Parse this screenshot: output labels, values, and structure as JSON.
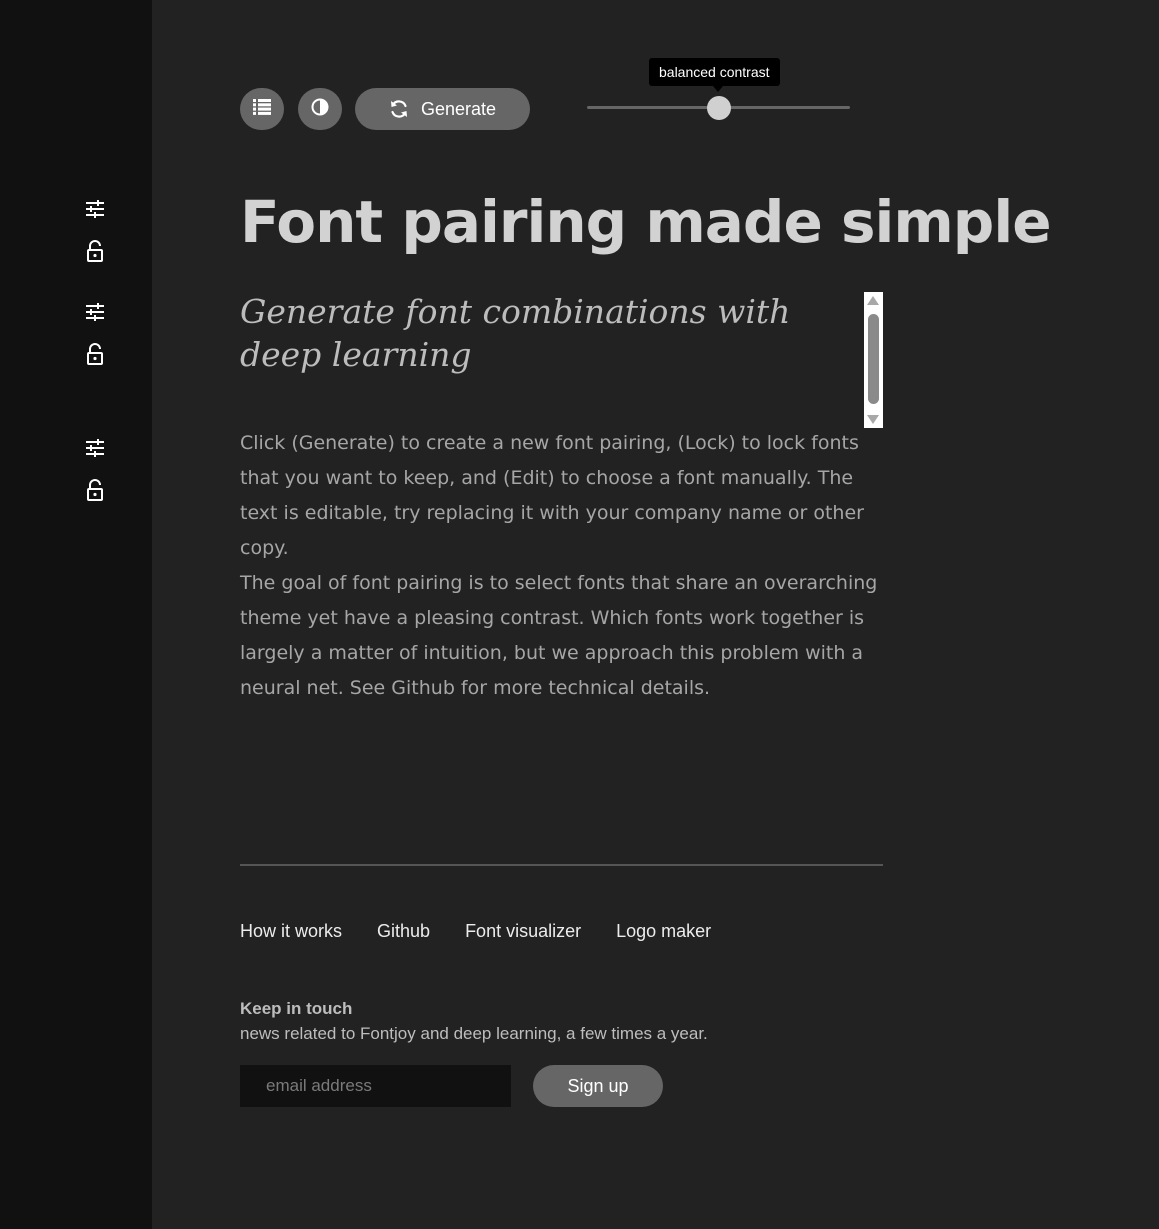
{
  "sidebar": {
    "font_slots": [
      {
        "edit_icon": "sliders-icon",
        "lock_icon": "unlock-icon"
      },
      {
        "edit_icon": "sliders-icon",
        "lock_icon": "unlock-icon"
      },
      {
        "edit_icon": "sliders-icon",
        "lock_icon": "unlock-icon"
      }
    ]
  },
  "toolbar": {
    "list_icon": "list-icon",
    "contrast_icon": "contrast-icon",
    "generate_icon": "refresh-icon",
    "generate_label": "Generate",
    "slider_value": 0.5,
    "slider_tooltip": "balanced contrast"
  },
  "content": {
    "headline": "Font pairing made simple",
    "subheadline": "Generate font combinations with deep learning",
    "paragraph1": "Click (Generate) to create a new font pairing, (Lock) to lock fonts that you want to keep, and (Edit) to choose a font manually. The text is editable, try replacing it with your company name or other copy.",
    "paragraph2": "The goal of font pairing is to select fonts that share an overarching theme yet have a pleasing contrast. Which fonts work together is largely a matter of intuition, but we approach this problem with a neural net. See Github for more technical details."
  },
  "footer": {
    "links": [
      "How it works",
      "Github",
      "Font visualizer",
      "Logo maker"
    ],
    "keep_title": "Keep in touch",
    "keep_subtitle": "news related to Fontjoy and deep learning, a few times a year.",
    "email_placeholder": "email address",
    "signup_label": "Sign up"
  },
  "colors": {
    "background": "#222222",
    "sidebar": "#111111",
    "button": "#666666"
  }
}
